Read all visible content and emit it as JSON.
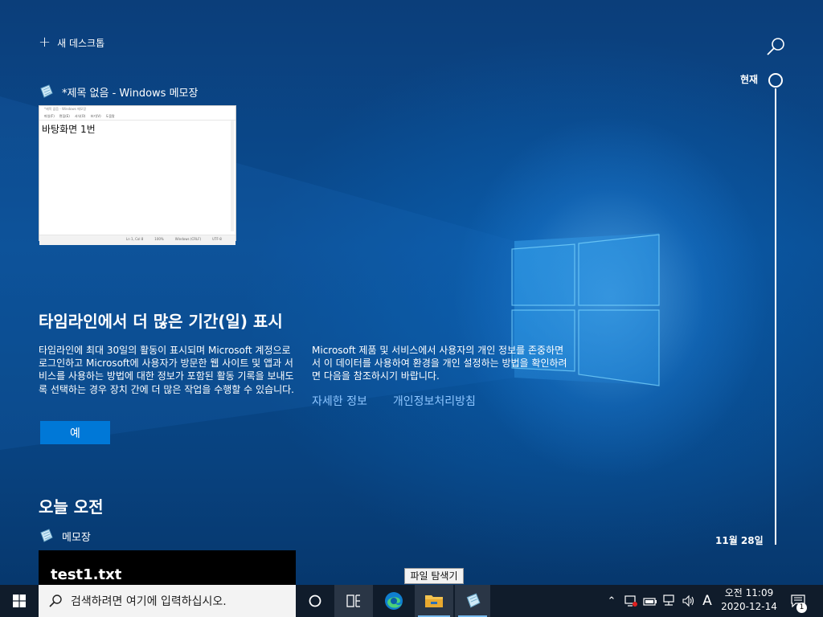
{
  "top_bar": {
    "new_desktop_label": "새 데스크톱"
  },
  "timeline": {
    "now_label": "현재",
    "date_label": "11월 28일"
  },
  "recent_window": {
    "app_title": "*제목 없음 - Windows 메모장",
    "thumbnail": {
      "title": "*제목 없음 - Windows 메모장",
      "menu": [
        "파일(F)",
        "편집(E)",
        "서식(O)",
        "보기(V)",
        "도움말"
      ],
      "body_text": "바탕화면 1번",
      "status": [
        "Ln 1, Col 8",
        "100%",
        "Windows (CRLF)",
        "UTF-8"
      ]
    }
  },
  "promo": {
    "title": "타임라인에서 더 많은 기간(일) 표시",
    "left_text": "타임라인에 최대 30일의 활동이 표시되며 Microsoft 계정으로 로그인하고 Microsoft에 사용자가 방문한 웹 사이트 및 앱과 서비스를 사용하는 방법에 대한 정보가 포함된 활동 기록을 보내도록 선택하는 경우 장치 간에 더 많은 작업을 수행할 수 있습니다.",
    "right_text": "Microsoft 제품 및 서비스에서 사용자의 개인 정보를 존중하면서 이 데이터를 사용하여 환경을 개인 설정하는 방법을 확인하려면 다음을 참조하시기 바랍니다.",
    "link_more": "자세한 정보",
    "link_privacy": "개인정보처리방침",
    "yes_button": "예"
  },
  "today": {
    "section_title": "오늘 오전",
    "app_name": "메모장",
    "file_name": "test1.txt"
  },
  "tooltip": "파일 탐색기",
  "taskbar": {
    "search_placeholder": "검색하려면 여기에 입력하십시오.",
    "ime_label": "A",
    "time": "오전 11:09",
    "date": "2020-12-14",
    "notification_count": "1"
  },
  "colors": {
    "accent": "#0078d7",
    "link": "#8ec6ff",
    "taskbar": "#101c2b"
  }
}
